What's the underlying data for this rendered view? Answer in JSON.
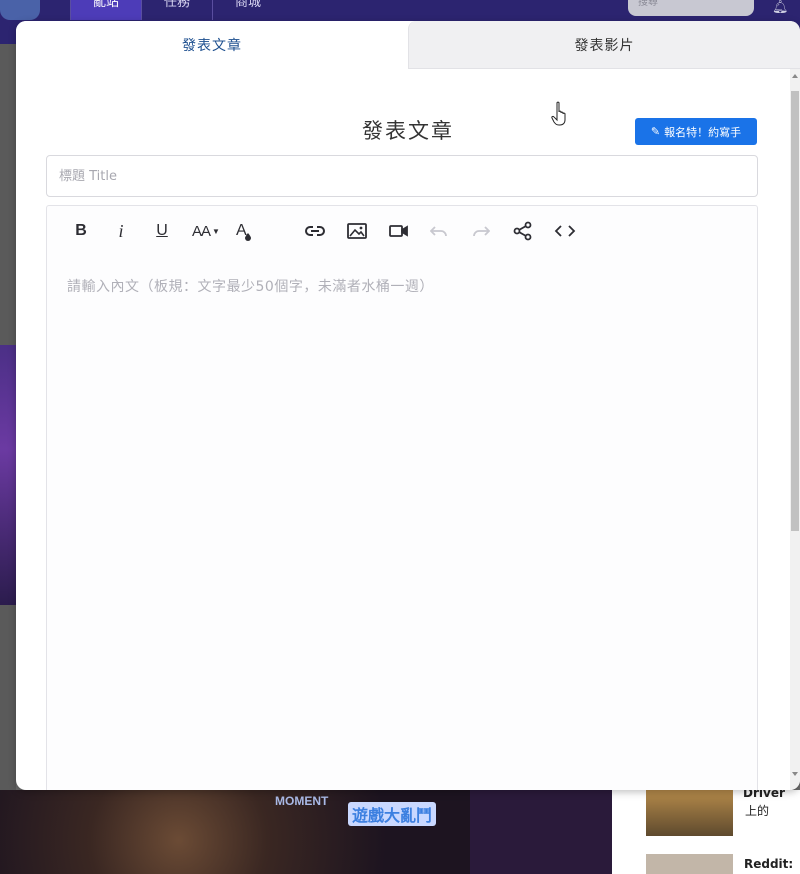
{
  "background": {
    "nav_items": [
      "亂站",
      "任務",
      "商城"
    ],
    "search_placeholder": "搜尋",
    "banner_text": "MOMENT",
    "banner_logo_text": "遊戲大亂鬥",
    "side_items": [
      {
        "title": "Driver",
        "subtitle": "上的 "
      },
      {
        "title": "Reddit:"
      }
    ]
  },
  "modal": {
    "tabs": [
      {
        "label": "發表文章",
        "active": true
      },
      {
        "label": "發表影片",
        "active": false
      }
    ],
    "heading": "發表文章",
    "recruit_button": "報名特！約寫手",
    "title_placeholder": "標題 Title",
    "title_value": "",
    "body_placeholder": "請輸入內文（板規：文字最少50個字，未滿者水桶一週）",
    "toolbar": {
      "bold": "B",
      "italic": "i",
      "underline": "U",
      "font_size": "AA",
      "items": [
        "bold-icon",
        "italic-icon",
        "underline-icon",
        "font-size-icon",
        "text-color-icon",
        "link-icon",
        "image-icon",
        "video-icon",
        "undo-icon",
        "redo-icon",
        "share-icon",
        "code-icon"
      ]
    }
  },
  "colors": {
    "accent": "#1a73e8",
    "active_tab_text": "#1d4f8f",
    "topbar": "#2c2470"
  }
}
